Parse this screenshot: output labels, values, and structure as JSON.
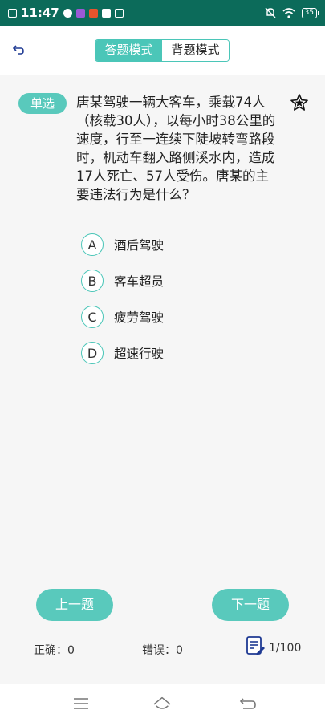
{
  "statusbar": {
    "time": "11:47",
    "battery": "35"
  },
  "header": {
    "modes": [
      "答题模式",
      "背题模式"
    ]
  },
  "question": {
    "type_tag": "单选",
    "text": "唐某驾驶一辆大客车，乘载74人（核载30人），以每小时38公里的速度，行至一连续下陡坡转弯路段时，机动车翻入路侧溪水内，造成17人死亡、57人受伤。唐某的主要违法行为是什么？",
    "options": [
      {
        "letter": "A",
        "text": "酒后驾驶"
      },
      {
        "letter": "B",
        "text": "客车超员"
      },
      {
        "letter": "C",
        "text": "疲劳驾驶"
      },
      {
        "letter": "D",
        "text": "超速行驶"
      }
    ]
  },
  "footer": {
    "prev_label": "上一题",
    "next_label": "下一题",
    "correct": "正确：0",
    "wrong": "错误：0",
    "progress": "1/100"
  },
  "colors": {
    "accent": "#59c9bc",
    "statusbar": "#0c6b5a"
  },
  "icons": [
    "back-icon",
    "star-icon",
    "answer-sheet-icon",
    "menu-icon",
    "home-icon",
    "back-nav-icon"
  ]
}
